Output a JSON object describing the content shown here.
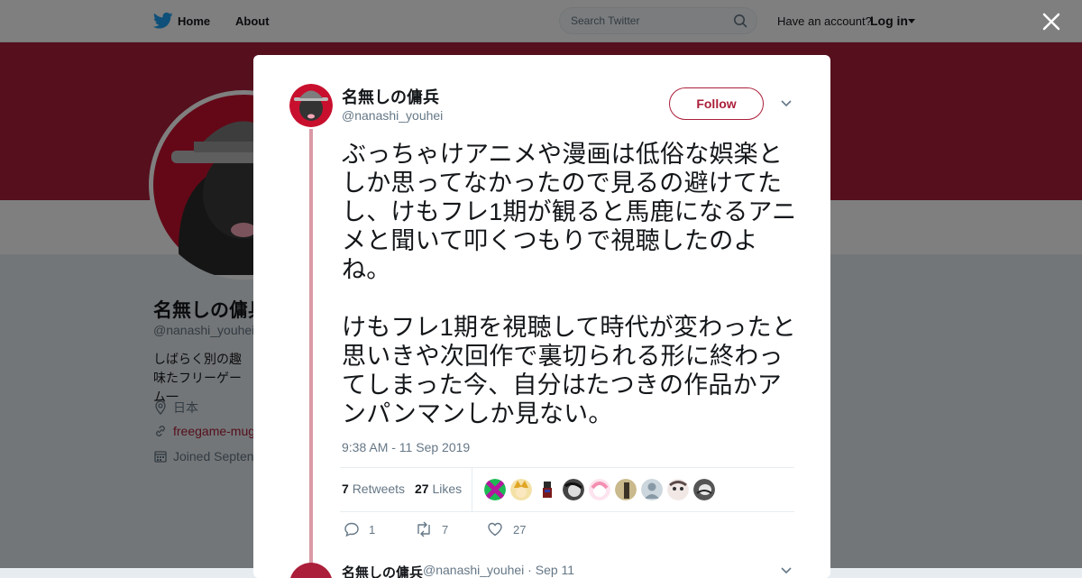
{
  "header": {
    "home_label": "Home",
    "about_label": "About",
    "search_placeholder": "Search Twitter",
    "account_prompt": "Have an account?",
    "login_label": "Log in"
  },
  "profile": {
    "name": "名無しの傭兵",
    "handle": "@nanashi_youhei",
    "bio": "しばらく別の趣味たフリーゲーム一",
    "location": "日本",
    "url": "freegame-mug",
    "joined": "Joined Septen"
  },
  "tweet": {
    "author_name": "名無しの傭兵",
    "author_handle": "@nanashi_youhei",
    "follow_label": "Follow",
    "text": "ぶっちゃけアニメや漫画は低俗な娯楽としか思ってなかったので見るの避けてたし、けもフレ1期が観ると馬鹿になるアニメと聞いて叩くつもりで視聴したのよね。\n\nけもフレ1期を視聴して時代が変わったと思いきや次回作で裏切られる形に終わってしまった今、自分はたつきの作品かアンパンマンしか見ない。",
    "timestamp": "9:38 AM - 11 Sep 2019",
    "retweets_count": "7",
    "retweets_label": "Retweets",
    "likes_count": "27",
    "likes_label": "Likes",
    "reply_count": "1",
    "retweet_action_count": "7",
    "like_action_count": "27"
  },
  "next_tweet": {
    "author_name": "名無しの傭兵",
    "meta": "@nanashi_youhei · Sep 11"
  },
  "colors": {
    "accent": "#ab1f3a",
    "twitter_blue": "#1da1f2",
    "muted_text": "#657786"
  }
}
